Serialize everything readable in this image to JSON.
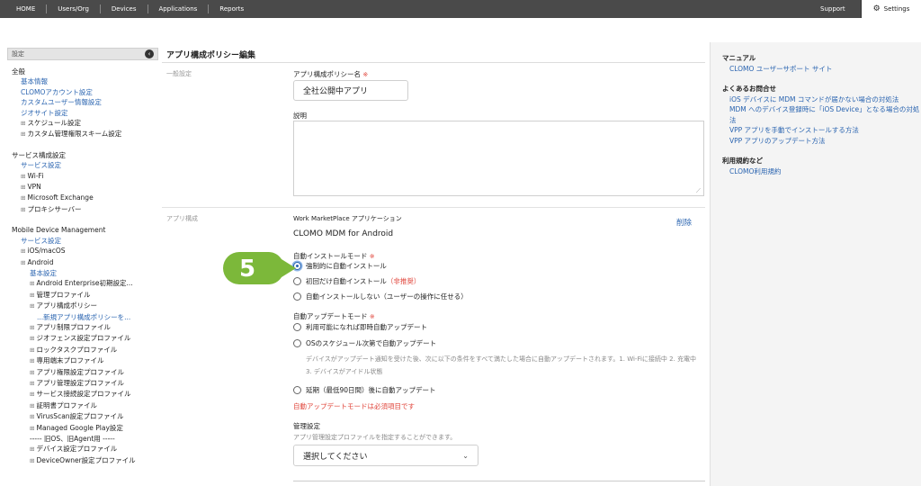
{
  "topnav": {
    "items": [
      "HOME",
      "Users/Org",
      "Devices",
      "Applications",
      "Reports"
    ],
    "support": "Support",
    "settings": "Settings"
  },
  "sidebar": {
    "header": "設定",
    "collapse_icon": "chevron-left-icon",
    "lines": [
      {
        "t": "section",
        "text": "全般"
      },
      {
        "t": "link",
        "text": "基本情報"
      },
      {
        "t": "link",
        "text": "CLOMOアカウント設定"
      },
      {
        "t": "link",
        "text": "カスタムユーザー情報設定"
      },
      {
        "t": "link",
        "text": "ジオサイト設定"
      },
      {
        "t": "sub",
        "text": "スケジュール設定"
      },
      {
        "t": "sub",
        "text": "カスタム管理権限スキーム設定"
      },
      {
        "t": "gap"
      },
      {
        "t": "section",
        "text": "サービス構成設定"
      },
      {
        "t": "link",
        "text": "サービス設定"
      },
      {
        "t": "sub",
        "text": "Wi-Fi"
      },
      {
        "t": "sub",
        "text": "VPN"
      },
      {
        "t": "sub",
        "text": "Microsoft Exchange"
      },
      {
        "t": "sub",
        "text": "プロキシサーバー"
      },
      {
        "t": "gap"
      },
      {
        "t": "section",
        "text": "Mobile Device Management"
      },
      {
        "t": "link",
        "text": "サービス設定"
      },
      {
        "t": "sub",
        "text": "iOS/macOS"
      },
      {
        "t": "sub",
        "text": "Android"
      },
      {
        "t": "link2",
        "text": "基本設定"
      },
      {
        "t": "sub2",
        "text": "Android Enterprise初期設定..."
      },
      {
        "t": "sub2",
        "text": "管理プロファイル"
      },
      {
        "t": "sub2",
        "text": "アプリ構成ポリシー"
      },
      {
        "t": "link3",
        "text": "...新規アプリ構成ポリシーを..."
      },
      {
        "t": "sub2",
        "text": "アプリ制限プロファイル"
      },
      {
        "t": "sub2",
        "text": "ジオフェンス設定プロファイル"
      },
      {
        "t": "sub2",
        "text": "ロックタスクプロファイル"
      },
      {
        "t": "sub2",
        "text": "専用端末プロファイル"
      },
      {
        "t": "sub2",
        "text": "アプリ権限設定プロファイル"
      },
      {
        "t": "sub2",
        "text": "アプリ管理設定プロファイル"
      },
      {
        "t": "sub2",
        "text": "サービス接続設定プロファイル"
      },
      {
        "t": "sub2",
        "text": "証明書プロファイル"
      },
      {
        "t": "sub2",
        "text": "VirusScan設定プロファイル"
      },
      {
        "t": "sub2",
        "text": "Managed Google Play設定"
      },
      {
        "t": "plain2",
        "text": "----- 旧OS、旧Agent用 -----"
      },
      {
        "t": "sub2",
        "text": "デバイス設定プロファイル"
      },
      {
        "t": "sub2",
        "text": "DeviceOwner設定プロファイル"
      }
    ]
  },
  "main": {
    "title": "アプリ構成ポリシー編集",
    "general_label": "一般設定",
    "policy_name_label": "アプリ構成ポリシー名",
    "policy_name_value": "全社公開中アプリ",
    "required_mark": "※",
    "description_label": "説明",
    "app_config_label": "アプリ構成",
    "app_source": "Work MarketPlace アプリケーション",
    "delete": "削除",
    "app_name": "CLOMO MDM for Android",
    "install_mode_label": "自動インストールモード",
    "install_options": [
      {
        "text": "強制的に自動インストール",
        "selected": true
      },
      {
        "text": "初回だけ自動インストール",
        "suffix": "（非推奨）"
      },
      {
        "text": "自動インストールしない（ユーザーの操作に任せる）"
      }
    ],
    "update_mode_label": "自動アップデートモード",
    "update_opt1": "利用可能になれば即時自動アップデート",
    "update_opt2": "OSのスケジュール次第で自動アップデート",
    "update_note": "デバイスがアップデート通知を受けた後、次に以下の条件をすべて満たした場合に自動アップデートされます。1. Wi-Fiに接続中 2. 充電中 3. デバイスがアイドル状態",
    "update_opt3": "延期（最低90日間）後に自動アップデート",
    "update_error": "自動アップデートモードは必須項目です",
    "mgmt_label": "管理設定",
    "mgmt_hint": "アプリ管理設定プロファイルを指定することができます。",
    "mgmt_select": "選択してください",
    "step_badge": "5",
    "colors": {
      "accent": "#2a64b0",
      "badge": "#7cb83a",
      "error": "#e0443a"
    }
  },
  "rightcol": {
    "manual_heading": "マニュアル",
    "manual_link": "CLOMO ユーザーサポート サイト",
    "faq_heading": "よくあるお問合せ",
    "faq_links": [
      "iOS デバイスに MDM コマンドが届かない場合の対処法",
      "MDM へのデバイス登録時に「iOS Device」となる場合の対処法",
      "VPP アプリを手動でインストールする方法",
      "VPP アプリのアップデート方法"
    ],
    "terms_heading": "利用規約など",
    "terms_link": "CLOMO利用規約"
  }
}
